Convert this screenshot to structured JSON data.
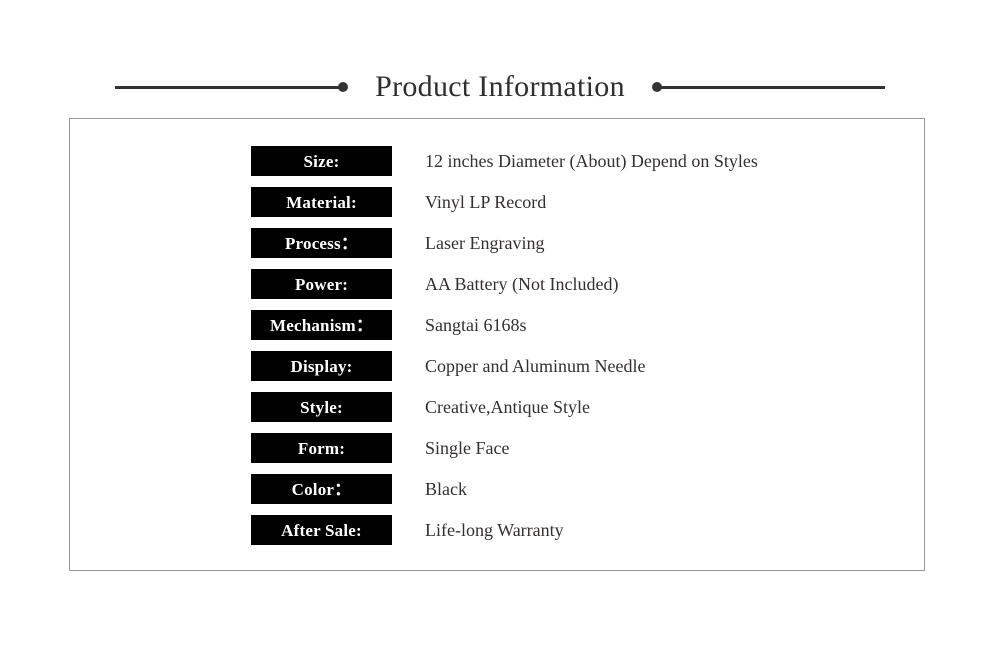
{
  "header": {
    "title": "Product Information",
    "rule_color": "#333333",
    "title_color": "#2f2f2f"
  },
  "panel": {
    "border_color": "#999999",
    "label_bg": "#000000",
    "label_color": "#ffffff",
    "value_color": "#33302f",
    "specs": [
      {
        "label": "Size:",
        "value": "12 inches Diameter (About) Depend on Styles"
      },
      {
        "label": "Material:",
        "value": "Vinyl LP Record"
      },
      {
        "label": "Process：",
        "value": "Laser Engraving"
      },
      {
        "label": "Power:",
        "value": "AA Battery (Not Included)"
      },
      {
        "label": "Mechanism：",
        "value": "Sangtai 6168s"
      },
      {
        "label": "Display:",
        "value": "Copper and Aluminum Needle"
      },
      {
        "label": "Style:",
        "value": "Creative,Antique Style"
      },
      {
        "label": "Form:",
        "value": "Single Face"
      },
      {
        "label": "Color：",
        "value": "Black"
      },
      {
        "label": "After Sale:",
        "value": "Life-long Warranty"
      }
    ]
  }
}
